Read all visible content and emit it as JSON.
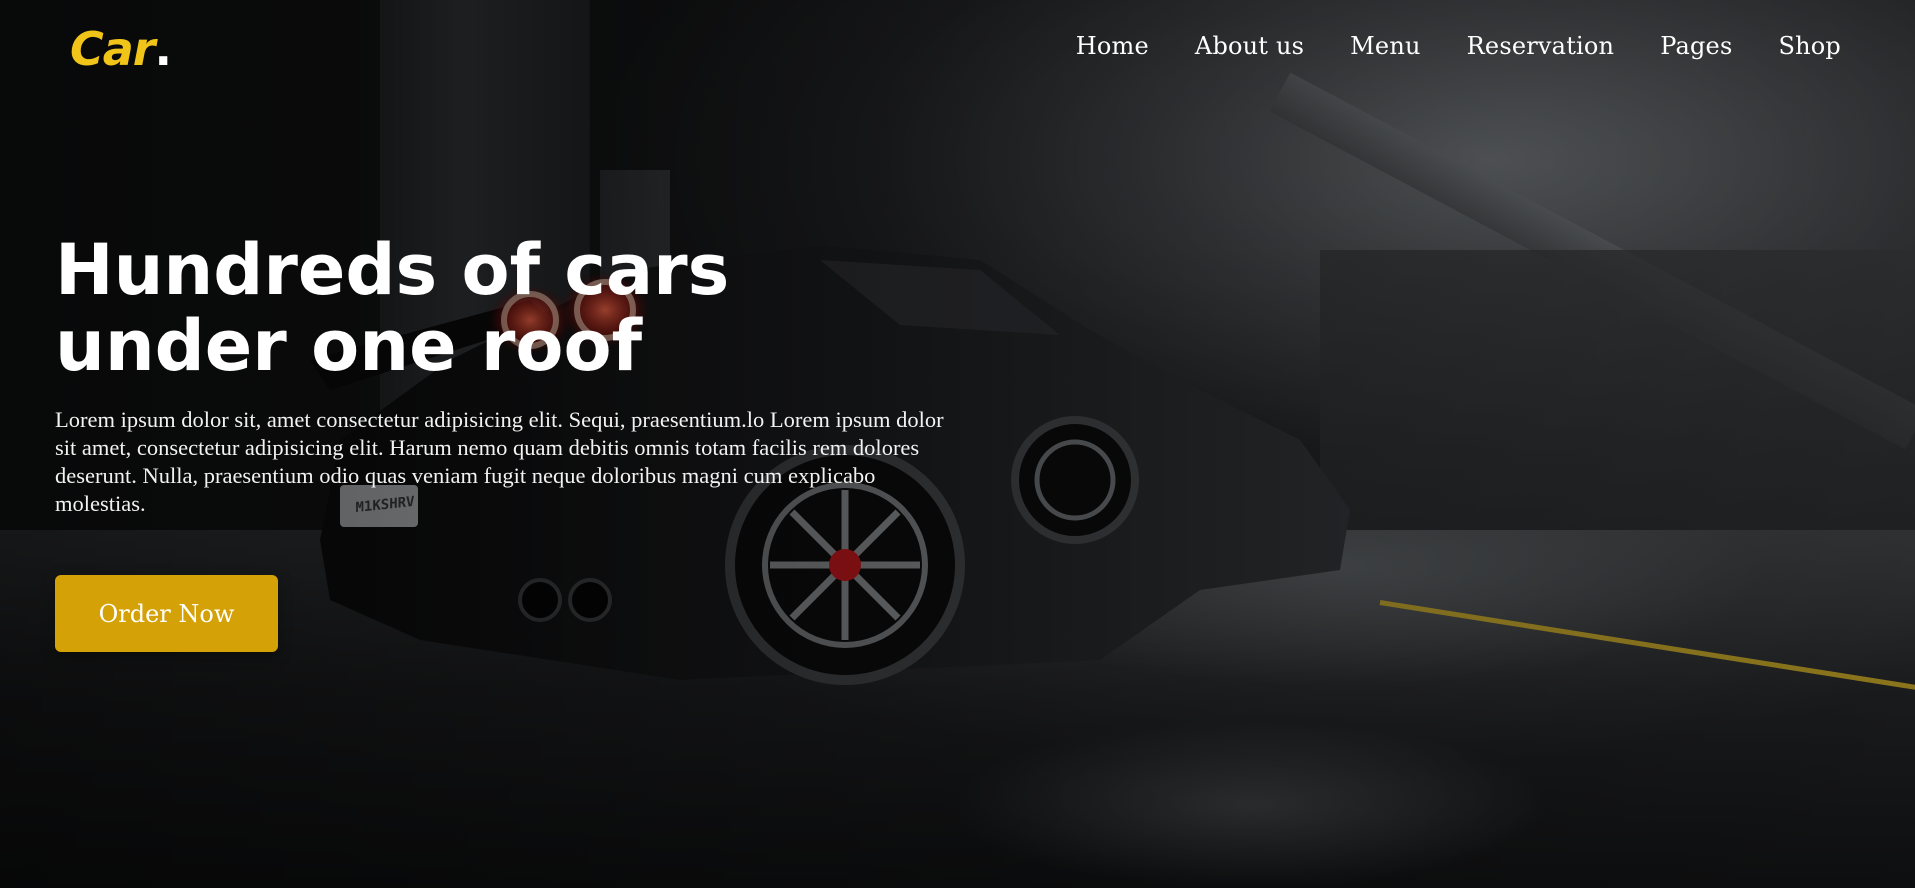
{
  "brand": {
    "name": "Car",
    "dot": ".",
    "accent_color": "#f0c419"
  },
  "nav": {
    "items": [
      {
        "label": "Home"
      },
      {
        "label": "About us"
      },
      {
        "label": "Menu"
      },
      {
        "label": "Reservation"
      },
      {
        "label": "Pages"
      },
      {
        "label": "Shop"
      }
    ]
  },
  "hero": {
    "headline": "Hundreds of cars under one roof",
    "description": "Lorem ipsum dolor sit, amet consectetur adipisicing elit. Sequi, praesentium.lo Lorem ipsum dolor sit amet, consectetur adipisicing elit. Harum nemo quam debitis omnis totam facilis rem dolores deserunt. Nulla, praesentium odio quas veniam fugit neque doloribus magni cum explicabo molestias.",
    "cta_label": "Order Now",
    "cta_color": "#d4a106",
    "license_plate": "M1KSHRV"
  }
}
